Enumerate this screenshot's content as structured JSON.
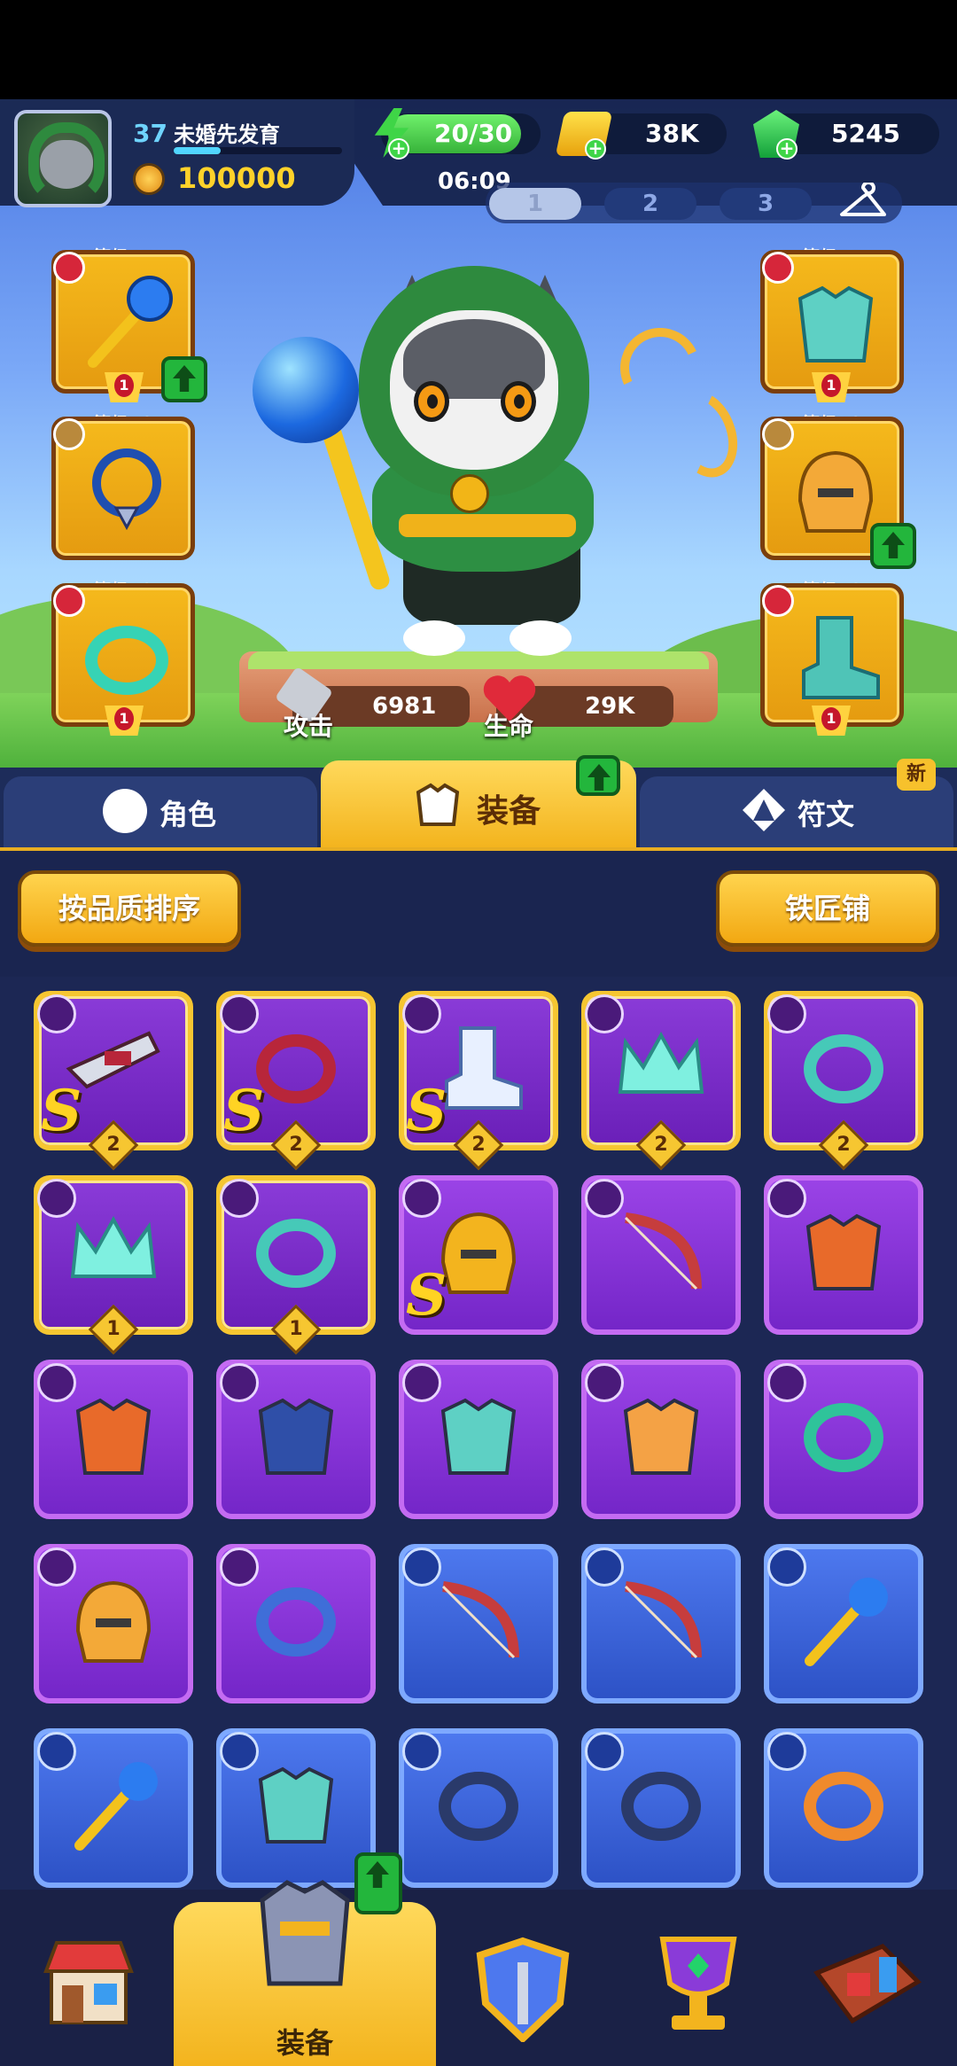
{
  "player": {
    "level": "37",
    "name": "未婚先发育",
    "xp_fraction": 0.28,
    "coins": "100000"
  },
  "resources": {
    "energy": "20/30",
    "timer": "06:09",
    "gold": "38K",
    "gems": "5245"
  },
  "loadouts": [
    "1",
    "2",
    "3"
  ],
  "equipped": [
    {
      "level_label": "等级47",
      "icon": "staff-icon"
    },
    {
      "level_label": "等级50",
      "icon": "necklace-icon"
    },
    {
      "level_label": "等级49",
      "icon": "ring-icon"
    },
    {
      "level_label": "等级51",
      "icon": "armor-icon"
    },
    {
      "level_label": "等级49",
      "icon": "helmet-icon"
    },
    {
      "level_label": "等级48",
      "icon": "boots-icon"
    }
  ],
  "stats": {
    "attack_label": "攻击",
    "attack_value": "6981",
    "hp_label": "生命",
    "hp_value": "29K"
  },
  "tabs": {
    "character": "角色",
    "equipment": "装备",
    "runes": "符文",
    "new_badge": "新"
  },
  "actions": {
    "sort_by_quality": "按品质排序",
    "blacksmith": "铁匠铺"
  },
  "grade_letter": "S",
  "inventory_stars": [
    "2",
    "2",
    "2",
    "2",
    "2",
    "1",
    "1"
  ],
  "bottom_nav": {
    "active_label": "装备"
  },
  "colors": {
    "legendary_border": "#f6c631",
    "epic_bg": "#8a3bd8",
    "rare_bg": "#4d78ee",
    "accent_green": "#23b63c"
  }
}
